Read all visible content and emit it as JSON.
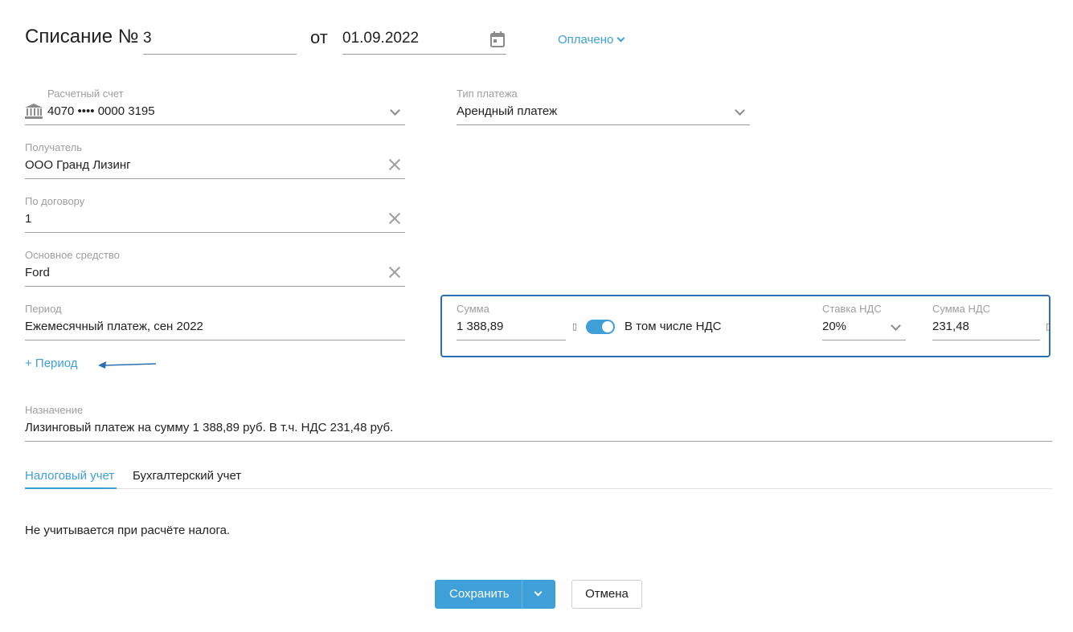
{
  "header": {
    "title": "Списание №",
    "number": "3",
    "from_label": "от",
    "date": "01.09.2022",
    "status": "Оплачено"
  },
  "fields": {
    "account": {
      "label": "Расчетный счет",
      "value": "4070 •••• 0000 3195"
    },
    "payment_type": {
      "label": "Тип платежа",
      "value": "Арендный платеж"
    },
    "recipient": {
      "label": "Получатель",
      "value": "ООО Гранд Лизинг"
    },
    "contract": {
      "label": "По договору",
      "value": "1"
    },
    "asset": {
      "label": "Основное средство",
      "value": "Ford"
    },
    "period": {
      "label": "Период",
      "value": "Ежемесячный платеж, сен 2022"
    },
    "add_period": "+ Период",
    "purpose": {
      "label": "Назначение",
      "value": "Лизинговый платеж на сумму 1 388,89 руб. В т.ч. НДС 231,48 руб."
    }
  },
  "amount_block": {
    "sum_label": "Сумма",
    "sum_value": "1 388,89",
    "vat_toggle_label": "В том числе НДС",
    "vat_included": true,
    "vat_rate_label": "Ставка НДС",
    "vat_rate_value": "20%",
    "vat_sum_label": "Сумма НДС",
    "vat_sum_value": "231,48"
  },
  "tabs": [
    {
      "label": "Налоговый учет",
      "active": true
    },
    {
      "label": "Бухгалтерский учет",
      "active": false
    }
  ],
  "tab_content": "Не учитывается при расчёте налога.",
  "actions": {
    "save": "Сохранить",
    "cancel": "Отмена"
  },
  "colors": {
    "accent": "#3f9fd8",
    "highlight_border": "#2b6fb3",
    "arrow": "#2b6fb3"
  }
}
